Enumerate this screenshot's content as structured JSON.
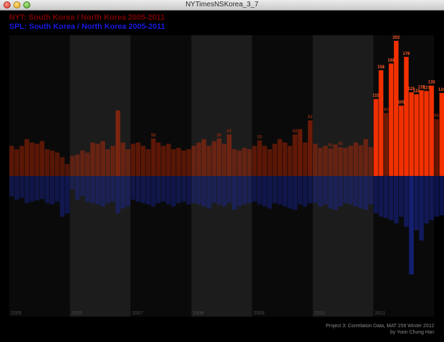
{
  "window": {
    "title": "NYTimesNSKorea_3_7"
  },
  "header": {
    "line1": "NYT: South Korea / North Korea 2005-2011",
    "line2": "SPL: South Korea / North Korea 2005-2011"
  },
  "footer": {
    "line1": "Project 3: Correlation Data, MAT 259 Winter 2012",
    "line2": "by Yoon Chung Han"
  },
  "colors": {
    "background": "#000000",
    "nyt_series": "#ff3300",
    "spl_series": "#1a2aa8",
    "header_nyt": "#7a0000",
    "header_spl": "#1a1ae0",
    "year_band_dark": "#0a0a0a",
    "year_band_light": "#1c1c1c"
  },
  "chart_data": {
    "type": "bar",
    "title": "NYT: South Korea / North Korea 2005-2011",
    "subtitle": "SPL: South Korea / North Korea 2005-2011",
    "x_axis": "monthly, 2005-01 to 2011-12",
    "years": [
      "2005",
      "2006",
      "2007",
      "2008",
      "2009",
      "2010",
      "2011"
    ],
    "layout": "mirrored bars: NYT above baseline, SPL below baseline",
    "grid": false,
    "series": [
      {
        "name": "NYT",
        "values": [
          45,
          40,
          45,
          55,
          50,
          48,
          52,
          40,
          38,
          35,
          28,
          18,
          30,
          32,
          38,
          35,
          50,
          48,
          52,
          40,
          45,
          98,
          50,
          40,
          48,
          50,
          45,
          40,
          56,
          50,
          45,
          48,
          40,
          42,
          38,
          40,
          45,
          50,
          55,
          45,
          52,
          56,
          48,
          62,
          40,
          38,
          42,
          40,
          45,
          53,
          45,
          40,
          48,
          55,
          50,
          45,
          62,
          70,
          50,
          83,
          48,
          42,
          45,
          41,
          47,
          43,
          42,
          45,
          50,
          46,
          55,
          43,
          115,
          158,
          94,
          168,
          202,
          105,
          178,
          125,
          122,
          128,
          127,
          135,
          85,
          124,
          65,
          74,
          73,
          50,
          46,
          40,
          35,
          34,
          35,
          50
        ],
        "labels": [
          "",
          "",
          "",
          "",
          "",
          "",
          "",
          "",
          "",
          "",
          "",
          "",
          "",
          "",
          "",
          "",
          "",
          "",
          "",
          "",
          "",
          "",
          "",
          "",
          "",
          "",
          "",
          "",
          "56",
          "",
          "",
          "",
          "",
          "",
          "",
          "",
          "",
          "",
          "",
          "",
          "",
          "56",
          "",
          "62",
          "",
          "",
          "",
          "",
          "",
          "53",
          "",
          "",
          "",
          "",
          "",
          "",
          "62",
          "",
          "",
          "83",
          "",
          "",
          "",
          "41",
          "",
          "43",
          "",
          "",
          "",
          "",
          "",
          "",
          "115",
          "158",
          "94",
          "168",
          "202",
          "105",
          "178",
          "125",
          "122",
          "128",
          "127",
          "135",
          "85",
          "124",
          "",
          "74",
          "73",
          "",
          "46",
          "",
          "",
          "",
          "",
          ""
        ]
      },
      {
        "name": "SPL",
        "values": [
          30,
          35,
          32,
          40,
          38,
          36,
          34,
          40,
          42,
          38,
          60,
          55,
          20,
          35,
          30,
          38,
          40,
          42,
          45,
          40,
          38,
          55,
          48,
          45,
          35,
          38,
          40,
          42,
          45,
          40,
          38,
          42,
          45,
          40,
          38,
          42,
          40,
          42,
          45,
          48,
          40,
          42,
          45,
          40,
          50,
          45,
          42,
          40,
          38,
          42,
          45,
          48,
          40,
          42,
          45,
          48,
          50,
          42,
          45,
          40,
          40,
          45,
          42,
          48,
          50,
          45,
          40,
          42,
          45,
          48,
          50,
          42,
          55,
          60,
          62,
          65,
          70,
          60,
          75,
          145,
          80,
          95,
          70,
          65,
          60,
          58,
          55,
          50,
          48,
          45,
          42,
          40,
          38,
          36,
          40,
          60
        ]
      }
    ],
    "ylim_top": [
      0,
      202
    ],
    "ylim_bottom": [
      0,
      202
    ]
  }
}
